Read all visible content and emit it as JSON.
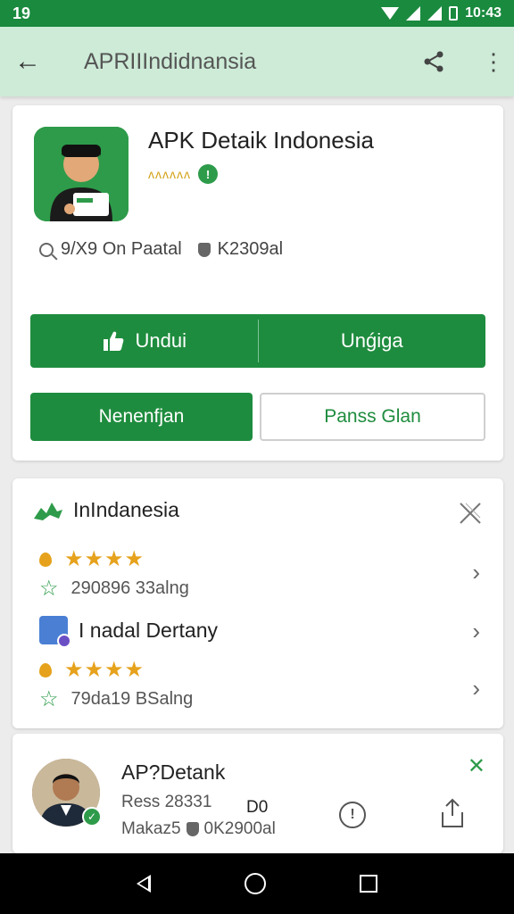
{
  "status_bar": {
    "time": "19",
    "clock": "10:43",
    "colors": {
      "bg": "#1a8a3e"
    }
  },
  "app_bar": {
    "title": "APRIIIndidnansia",
    "back_icon": "arrow-left-icon",
    "share_icon": "share-icon",
    "more_icon": "more-vert-icon"
  },
  "app_card": {
    "name": "APK Detaik Indonesia",
    "rating_text": "ʌʌʌʌʌʌ",
    "meta_left": "9/X9 On Paatal",
    "meta_right": "K2309al",
    "primary_buttons": [
      {
        "label": "Undui",
        "icon": "thumbs-up-icon"
      },
      {
        "label": "Unǵiga"
      }
    ],
    "secondary_buttons": [
      {
        "label": "Nenenfjan",
        "style": "filled"
      },
      {
        "label": "Panss Glan",
        "style": "outline"
      }
    ],
    "accent": "#1e8c3e"
  },
  "reviews_card": {
    "header": "InIndanesia",
    "items": [
      {
        "stars": "★★★★",
        "rating_value": 3.5,
        "text": "290896 33alng"
      },
      {
        "name": "I nadal Dertany"
      },
      {
        "stars": "★★★★",
        "rating_value": 3.5,
        "text": "79da19 BSalng"
      }
    ]
  },
  "profile_card": {
    "title": "AP?Detank",
    "line1": "Ress 28331",
    "line1b": "D0",
    "line2_left": "Makaz5",
    "line2_right": "0K2900al"
  },
  "nav": {
    "back": "triangle-back-icon",
    "home": "circle-home-icon",
    "recent": "square-recent-icon"
  }
}
